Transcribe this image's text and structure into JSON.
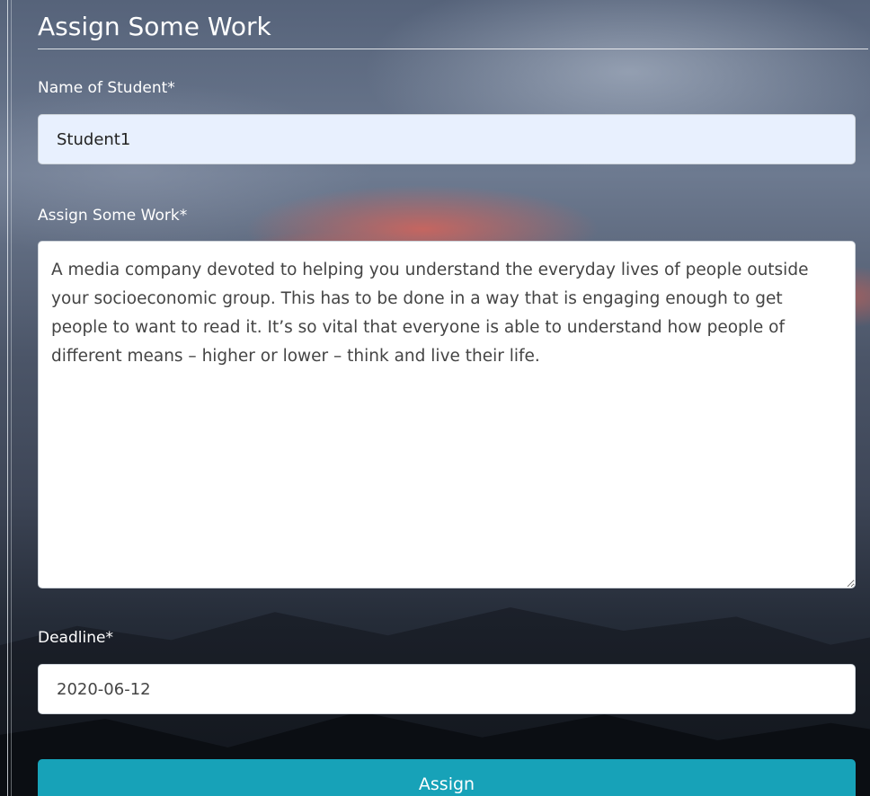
{
  "form": {
    "title": "Assign Some Work",
    "student_name": {
      "label": "Name of Student*",
      "value": "Student1"
    },
    "work": {
      "label": "Assign Some Work*",
      "value": "A media company devoted to helping you understand the everyday lives of people outside your socioeconomic group. This has to be done in a way that is engaging enough to get people to want to read it. It’s so vital that everyone is able to understand how people of different means – higher or lower – think and live their life."
    },
    "deadline": {
      "label": "Deadline*",
      "value": "2020-06-12"
    },
    "submit_label": "Assign"
  },
  "colors": {
    "submit_button": "#17a2b8",
    "autofill_background": "#e8f0fe"
  }
}
